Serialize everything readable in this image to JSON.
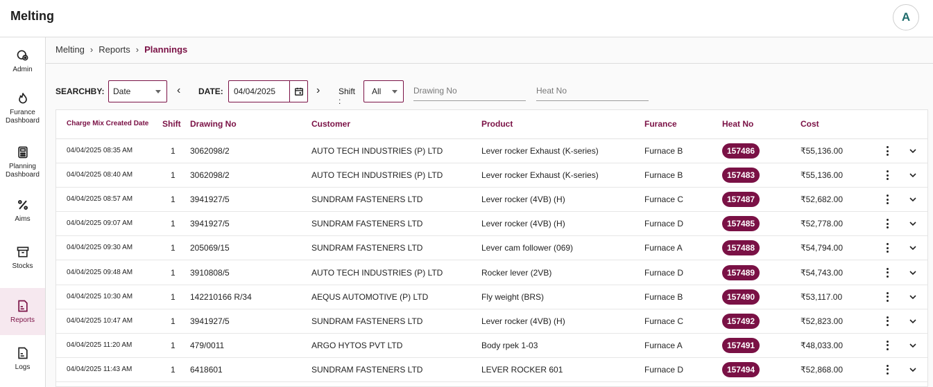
{
  "app": {
    "title": "Melting",
    "avatar_letter": "A"
  },
  "sidebar": {
    "items": [
      {
        "label": "Admin",
        "icon": "admin-gear-icon"
      },
      {
        "label": "Furance Dashboard",
        "icon": "flame-icon"
      },
      {
        "label": "Planning Dashboard",
        "icon": "calculator-icon"
      },
      {
        "label": "Aims",
        "icon": "percent-icon"
      },
      {
        "label": "Stocks",
        "icon": "archive-box-icon"
      },
      {
        "label": "Reports",
        "icon": "report-document-icon",
        "active": true
      },
      {
        "label": "Logs",
        "icon": "log-document-icon"
      }
    ]
  },
  "breadcrumb": {
    "items": [
      "Melting",
      "Reports"
    ],
    "current": "Plannings"
  },
  "filters": {
    "searchby_label": "SEARCHBY:",
    "searchby_value": "Date",
    "date_label": "DATE:",
    "date_value": "04/04/2025",
    "shift_label": "Shift :",
    "shift_value": "All",
    "drawing_placeholder": "Drawing No",
    "heat_placeholder": "Heat No"
  },
  "table": {
    "headers": {
      "created": "Charge Mix Created Date",
      "shift": "Shift",
      "drawing": "Drawing No",
      "customer": "Customer",
      "product": "Product",
      "furnace": "Furance",
      "heat": "Heat No",
      "cost": "Cost"
    },
    "rows": [
      {
        "created": "04/04/2025 08:35 AM",
        "shift": "1",
        "drawing": "3062098/2",
        "customer": "AUTO TECH INDUSTRIES (P) LTD",
        "product": "Lever rocker Exhaust (K-series)",
        "furnace": "Furnace B",
        "heat": "157486",
        "cost": "₹55,136.00"
      },
      {
        "created": "04/04/2025 08:40 AM",
        "shift": "1",
        "drawing": "3062098/2",
        "customer": "AUTO TECH INDUSTRIES (P) LTD",
        "product": "Lever rocker Exhaust (K-series)",
        "furnace": "Furnace B",
        "heat": "157483",
        "cost": "₹55,136.00"
      },
      {
        "created": "04/04/2025 08:57 AM",
        "shift": "1",
        "drawing": "3941927/5",
        "customer": "SUNDRAM FASTENERS LTD",
        "product": "Lever rocker (4VB) (H)",
        "furnace": "Furnace C",
        "heat": "157487",
        "cost": "₹52,682.00"
      },
      {
        "created": "04/04/2025 09:07 AM",
        "shift": "1",
        "drawing": "3941927/5",
        "customer": "SUNDRAM FASTENERS LTD",
        "product": "Lever rocker (4VB) (H)",
        "furnace": "Furnace D",
        "heat": "157485",
        "cost": "₹52,778.00"
      },
      {
        "created": "04/04/2025 09:30 AM",
        "shift": "1",
        "drawing": "205069/15",
        "customer": "SUNDRAM FASTENERS LTD",
        "product": "Lever cam follower (069)",
        "furnace": "Furnace A",
        "heat": "157488",
        "cost": "₹54,794.00"
      },
      {
        "created": "04/04/2025 09:48 AM",
        "shift": "1",
        "drawing": "3910808/5",
        "customer": "AUTO TECH INDUSTRIES (P) LTD",
        "product": "Rocker lever (2VB)",
        "furnace": "Furnace D",
        "heat": "157489",
        "cost": "₹54,743.00"
      },
      {
        "created": "04/04/2025 10:30 AM",
        "shift": "1",
        "drawing": "142210166 R/34",
        "customer": "AEQUS AUTOMOTIVE (P) LTD",
        "product": "Fly weight (BRS)",
        "furnace": "Furnace B",
        "heat": "157490",
        "cost": "₹53,117.00"
      },
      {
        "created": "04/04/2025 10:47 AM",
        "shift": "1",
        "drawing": "3941927/5",
        "customer": "SUNDRAM FASTENERS LTD",
        "product": "Lever rocker (4VB) (H)",
        "furnace": "Furnace C",
        "heat": "157492",
        "cost": "₹52,823.00"
      },
      {
        "created": "04/04/2025 11:20 AM",
        "shift": "1",
        "drawing": "479/0011",
        "customer": "ARGO HYTOS PVT LTD",
        "product": "Body rpek 1-03",
        "furnace": "Furnace A",
        "heat": "157491",
        "cost": "₹48,033.00"
      },
      {
        "created": "04/04/2025 11:43 AM",
        "shift": "1",
        "drawing": "6418601",
        "customer": "SUNDRAM FASTENERS LTD",
        "product": "LEVER ROCKER 601",
        "furnace": "Furnace D",
        "heat": "157494",
        "cost": "₹52,868.00"
      }
    ]
  },
  "colors": {
    "accent": "#7a1145",
    "active_bg": "#f6e8ef"
  }
}
